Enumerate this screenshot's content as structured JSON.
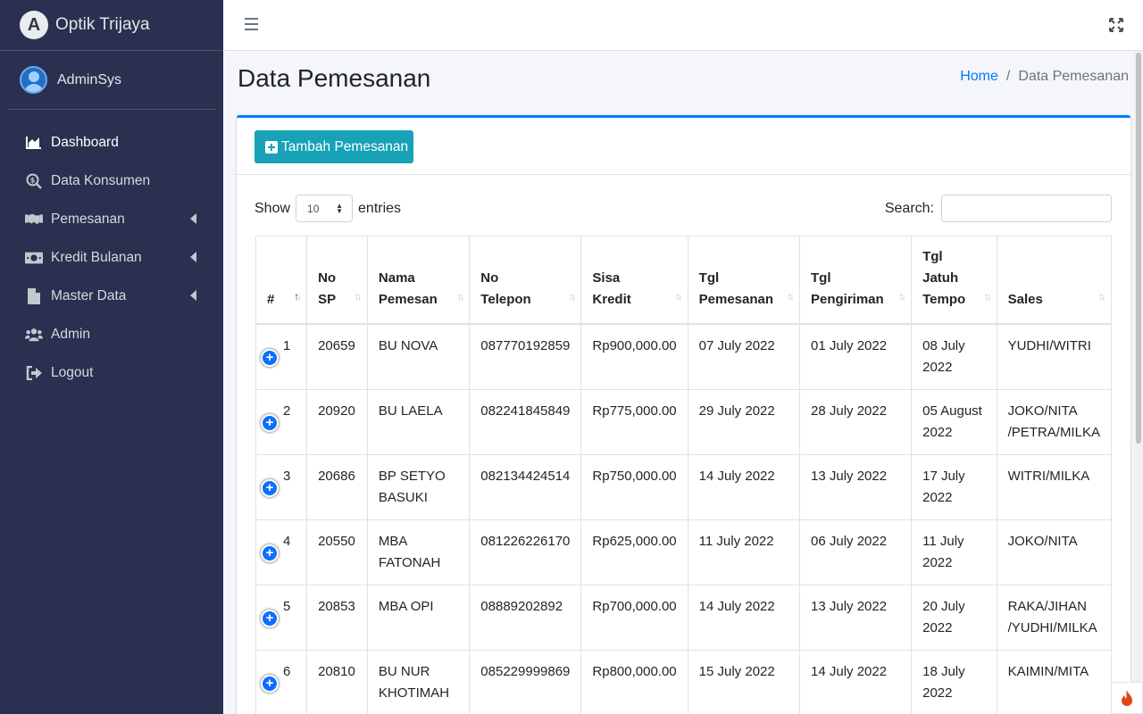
{
  "brand": {
    "name": "Optik Trijaya",
    "logo_letter": "A"
  },
  "user": {
    "name": "AdminSys"
  },
  "sidebar": {
    "items": [
      {
        "label": "Dashboard",
        "icon": "area-chart-icon",
        "active": true,
        "has_submenu": false
      },
      {
        "label": "Data Konsumen",
        "icon": "search-dollar-icon",
        "active": false,
        "has_submenu": false
      },
      {
        "label": "Pemesanan",
        "icon": "handshake-icon",
        "active": false,
        "has_submenu": true
      },
      {
        "label": "Kredit Bulanan",
        "icon": "money-bill-icon",
        "active": false,
        "has_submenu": true
      },
      {
        "label": "Master Data",
        "icon": "file-icon",
        "active": false,
        "has_submenu": true
      },
      {
        "label": "Admin",
        "icon": "users-icon",
        "active": false,
        "has_submenu": false
      },
      {
        "label": "Logout",
        "icon": "sign-out-icon",
        "active": false,
        "has_submenu": false
      }
    ]
  },
  "header": {
    "title": "Data Pemesanan",
    "breadcrumb": {
      "home": "Home",
      "separator": "/",
      "current": "Data Pemesanan"
    }
  },
  "card": {
    "add_button": "Tambah Pemesanan",
    "show_label": "Show",
    "entries_label": "entries",
    "page_size": "10",
    "search_label": "Search:",
    "search_value": ""
  },
  "table": {
    "columns": [
      {
        "lines": [
          "#"
        ]
      },
      {
        "lines": [
          "No",
          "SP"
        ]
      },
      {
        "lines": [
          "Nama",
          "Pemesan"
        ]
      },
      {
        "lines": [
          "No",
          "Telepon"
        ]
      },
      {
        "lines": [
          "Sisa",
          "Kredit"
        ]
      },
      {
        "lines": [
          "Tgl",
          "Pemesanan"
        ]
      },
      {
        "lines": [
          "Tgl",
          "Pengiriman"
        ]
      },
      {
        "lines": [
          "Tgl",
          "Jatuh",
          "Tempo"
        ]
      },
      {
        "lines": [
          "Sales"
        ]
      }
    ],
    "rows": [
      {
        "no": "1",
        "sp": "20659",
        "nama": "BU NOVA",
        "telepon": "087770192859",
        "kredit": "Rp900,000.00",
        "tgl_pesan": "07 July 2022",
        "tgl_kirim": "01 July 2022",
        "jatuh_tempo": "08 July 2022",
        "sales": "YUDHI/WITRI"
      },
      {
        "no": "2",
        "sp": "20920",
        "nama": "BU LAELA",
        "telepon": "082241845849",
        "kredit": "Rp775,000.00",
        "tgl_pesan": "29 July 2022",
        "tgl_kirim": "28 July 2022",
        "jatuh_tempo": "05 August 2022",
        "sales": "JOKO/NITA /PETRA/MILKA"
      },
      {
        "no": "3",
        "sp": "20686",
        "nama": "BP SETYO BASUKI",
        "telepon": "082134424514",
        "kredit": "Rp750,000.00",
        "tgl_pesan": "14 July 2022",
        "tgl_kirim": "13 July 2022",
        "jatuh_tempo": "17 July 2022",
        "sales": "WITRI/MILKA"
      },
      {
        "no": "4",
        "sp": "20550",
        "nama": "MBA FATONAH",
        "telepon": "081226226170",
        "kredit": "Rp625,000.00",
        "tgl_pesan": "11 July 2022",
        "tgl_kirim": "06 July 2022",
        "jatuh_tempo": "11 July 2022",
        "sales": "JOKO/NITA"
      },
      {
        "no": "5",
        "sp": "20853",
        "nama": "MBA OPI",
        "telepon": "08889202892",
        "kredit": "Rp700,000.00",
        "tgl_pesan": "14 July 2022",
        "tgl_kirim": "13 July 2022",
        "jatuh_tempo": "20 July 2022",
        "sales": "RAKA/JIHAN /YUDHI/MILKA"
      },
      {
        "no": "6",
        "sp": "20810",
        "nama": "BU NUR KHOTIMAH",
        "telepon": "085229999869",
        "kredit": "Rp800,000.00",
        "tgl_pesan": "15 July 2022",
        "tgl_kirim": "14 July 2022",
        "jatuh_tempo": "18 July 2022",
        "sales": "KAIMIN/MITA"
      }
    ]
  },
  "colors": {
    "sidebar_bg": "#2b3050",
    "accent": "#007bff",
    "add_button": "#17a2b8",
    "expander": "#0d6efd"
  }
}
